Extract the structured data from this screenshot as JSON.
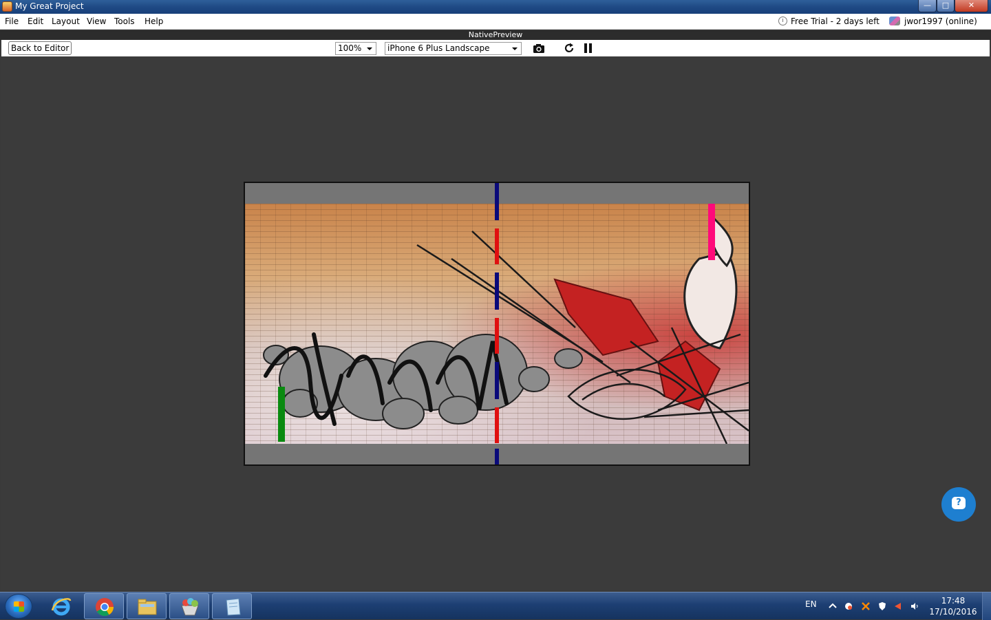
{
  "window": {
    "title": "My Great Project",
    "controls": {
      "minimize": "—",
      "maximize": "□",
      "close": "✕"
    }
  },
  "menu": {
    "items": [
      "File",
      "Edit",
      "Layout",
      "View",
      "Tools",
      "Help"
    ],
    "trial": "Free Trial - 2 days left",
    "user": "jwor1997 (online)"
  },
  "preview": {
    "header": "NativePreview",
    "back_label": "Back to Editor",
    "zoom": "100%",
    "device": "iPhone 6 Plus Landscape",
    "icons": [
      "camera-icon",
      "refresh-icon",
      "pause-icon"
    ]
  },
  "help_fab": {
    "icon": "help-chat-icon",
    "glyph": "?"
  },
  "colors": {
    "guide_navy": "#0a0a7a",
    "guide_red": "#e01010",
    "green_bar": "#0a8a10",
    "magenta_bar": "#ff0a7a",
    "help_fab": "#1e7fd0"
  },
  "taskbar": {
    "pinned": [
      "start-button",
      "internet-explorer-icon",
      "chrome-icon",
      "file-explorer-icon",
      "app-icon",
      "notepad-icon"
    ],
    "language": "EN",
    "time": "17:48",
    "date": "17/10/2016"
  }
}
